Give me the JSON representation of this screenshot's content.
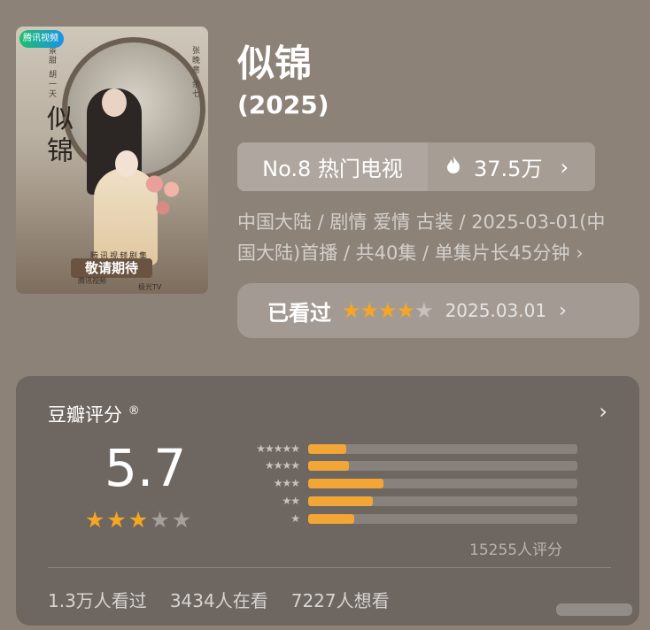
{
  "poster": {
    "platform_logo": "腾讯视频",
    "calligraphy": "似锦",
    "side_text_left": "景甜 胡一天",
    "side_text_right": "张晚意 余七",
    "banner_sub": "腾讯视频剧集",
    "banner_main": "敬请期待",
    "footer_left": "腾讯视频",
    "footer_right": "极光TV"
  },
  "title": "似锦",
  "year": "(2025)",
  "rank": {
    "label": "No.8 热门电视",
    "heat": "37.5万",
    "icon": "flame-icon"
  },
  "info": {
    "line1": "中国大陆 / 剧情 爱情 古装 / 2025-03-01(中",
    "line2": "国大陆)首播 / 共40集 / 单集片长45分钟"
  },
  "watched": {
    "label": "已看过",
    "user_stars": 4,
    "date": "2025.03.01"
  },
  "rating": {
    "header": "豆瓣评分",
    "mark": "®",
    "score": "5.7",
    "stars": 3,
    "count": "15255人评分",
    "distribution": [
      {
        "stars": 5,
        "share": 0.14
      },
      {
        "stars": 4,
        "share": 0.15
      },
      {
        "stars": 3,
        "share": 0.28
      },
      {
        "stars": 2,
        "share": 0.24
      },
      {
        "stars": 1,
        "share": 0.17
      }
    ]
  },
  "stats": {
    "watched": "1.3万人看过",
    "watching": "3434人在看",
    "want": "7227人想看"
  },
  "colors": {
    "background": "#8d8278",
    "card": "#6e6660",
    "star_accent": "#f5a623",
    "bar_fill": "#f1a636"
  }
}
